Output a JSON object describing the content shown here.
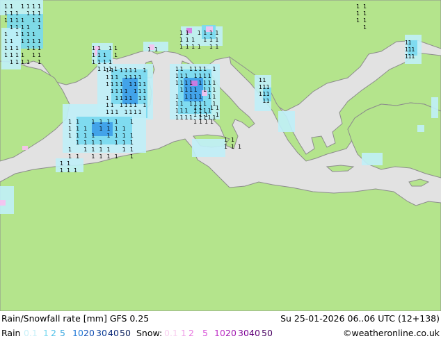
{
  "map": {
    "colors": {
      "sea": "#e2e2e2",
      "land": "#b4e48c",
      "coast": "#8c8c8c",
      "rain_light": "#c0f0f8",
      "rain_mid": "#78d8f0",
      "rain_heavy": "#3c9ce8",
      "snow_light": "#f8c0f0",
      "snow_mid": "#d878e0",
      "marker": "#000000"
    },
    "marker_glyph": "1"
  },
  "footer": {
    "title": "Rain/Snowfall rate [mm] GFS 0.25",
    "datetime": "Su 25-01-2026 06..06 UTC (12+138)",
    "rain_label": "Rain",
    "snow_label": "Snow:",
    "credit": "©weatheronline.co.uk",
    "rain_scale": [
      {
        "text": "0.1",
        "color": "#c8f0f8"
      },
      {
        "text": "1",
        "color": "#78d8f0"
      },
      {
        "text": "2",
        "color": "#50c0e8"
      },
      {
        "text": "5",
        "color": "#3ca8e0"
      },
      {
        "text": "10",
        "color": "#1e78d8"
      },
      {
        "text": "20",
        "color": "#1450b4"
      },
      {
        "text": "30",
        "color": "#0a3c96"
      },
      {
        "text": "40",
        "color": "#0a2878"
      },
      {
        "text": "50",
        "color": "#0a1e5a"
      }
    ],
    "snow_scale": [
      {
        "text": "0.1",
        "color": "#f8d0f0"
      },
      {
        "text": "1",
        "color": "#f0a0e8"
      },
      {
        "text": "2",
        "color": "#e878e0"
      },
      {
        "text": "5",
        "color": "#d850d8"
      },
      {
        "text": "10",
        "color": "#c030c8"
      },
      {
        "text": "20",
        "color": "#a018b0"
      },
      {
        "text": "30",
        "color": "#800898"
      },
      {
        "text": "40",
        "color": "#600078"
      },
      {
        "text": "50",
        "color": "#480060"
      }
    ]
  }
}
